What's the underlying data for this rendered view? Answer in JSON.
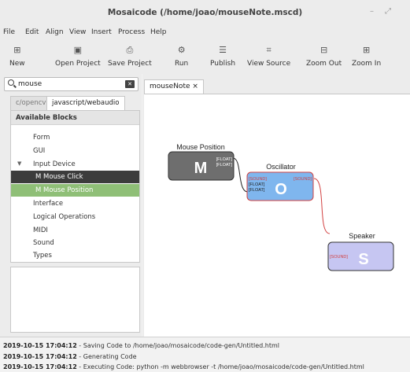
{
  "window": {
    "title": "Mosaicode (/home/joao/mouseNote.mscd)"
  },
  "menu": [
    "File",
    "Edit",
    "Align",
    "View",
    "Insert",
    "Process",
    "Help"
  ],
  "toolbar": [
    {
      "label": "New",
      "icon": "new-file-icon"
    },
    {
      "label": "Open Project",
      "icon": "open-project-icon"
    },
    {
      "label": "Save Project",
      "icon": "save-icon"
    },
    {
      "label": "Run",
      "icon": "run-gears-icon"
    },
    {
      "label": "Publish",
      "icon": "publish-list-icon"
    },
    {
      "label": "View Source",
      "icon": "view-source-icon"
    },
    {
      "label": "Zoom Out",
      "icon": "zoom-out-icon"
    },
    {
      "label": "Zoom In",
      "icon": "zoom-in-icon"
    }
  ],
  "search": {
    "value": "mouse"
  },
  "library_tabs": [
    "c/opencv",
    "javascript/webaudio"
  ],
  "blocks_panel": {
    "header": "Available Blocks",
    "items": [
      {
        "label": "Form"
      },
      {
        "label": "GUI"
      },
      {
        "label": "Input Device"
      },
      {
        "label": "M Mouse Click"
      },
      {
        "label": "M Mouse Position"
      },
      {
        "label": "Interface"
      },
      {
        "label": "Logical Operations"
      },
      {
        "label": "MIDI"
      },
      {
        "label": "Sound"
      },
      {
        "label": "Types"
      }
    ]
  },
  "diagram_tab": {
    "label": "mouseNote",
    "close": "×"
  },
  "diagram": {
    "blocks": [
      {
        "title": "Mouse Position",
        "letter": "M",
        "inputs": [],
        "outputs": [
          "[FLOAT]",
          "[FLOAT]"
        ],
        "color": "#6e6e6e"
      },
      {
        "title": "Oscillator",
        "letter": "O",
        "inputs": [
          "[SOUND]",
          "[FLOAT]",
          "[FLOAT]"
        ],
        "outputs": [
          "[SOUND]"
        ],
        "color": "#7fb6ee"
      },
      {
        "title": "Speaker",
        "letter": "S",
        "inputs": [
          "[SOUND]"
        ],
        "outputs": [],
        "color": "#c6c6f2"
      }
    ]
  },
  "log": [
    {
      "time": "2019-10-15 17:04:12",
      "msg": " - Saving Code to /home/joao/mosaicode/code-gen/Untitled.html"
    },
    {
      "time": "2019-10-15 17:04:12",
      "msg": " - Generating Code"
    },
    {
      "time": "2019-10-15 17:04:12",
      "msg": " - Executing Code: python -m webbrowser -t /home/joao/mosaicode/code-gen/Untitled.html"
    }
  ]
}
